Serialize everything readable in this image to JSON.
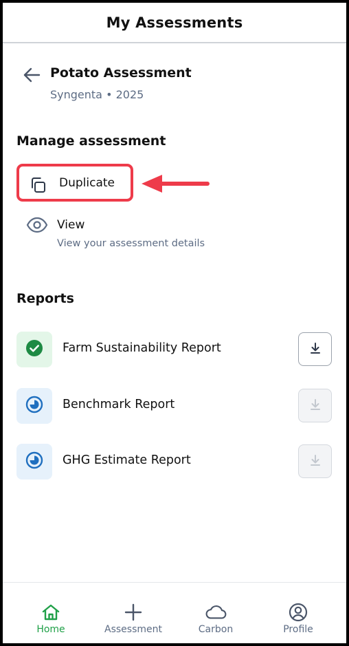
{
  "header": {
    "title": "My Assessments"
  },
  "assessment": {
    "name": "Potato Assessment",
    "subtitle": "Syngenta • 2025"
  },
  "manage": {
    "title": "Manage assessment",
    "duplicate_label": "Duplicate",
    "view_label": "View",
    "view_description": "View your assessment details"
  },
  "reports": {
    "title": "Reports",
    "items": [
      {
        "name": "Farm Sustainability Report",
        "status_icon": "check-circle-icon",
        "download_enabled": true
      },
      {
        "name": "Benchmark Report",
        "status_icon": "pending-clock-icon",
        "download_enabled": false
      },
      {
        "name": "GHG Estimate Report",
        "status_icon": "pending-clock-icon",
        "download_enabled": false
      }
    ]
  },
  "nav": {
    "items": [
      {
        "label": "Home",
        "icon": "home-icon",
        "active": true
      },
      {
        "label": "Assessment",
        "icon": "plus-icon",
        "active": false
      },
      {
        "label": "Carbon",
        "icon": "cloud-icon",
        "active": false
      },
      {
        "label": "Profile",
        "icon": "profile-icon",
        "active": false
      }
    ]
  },
  "colors": {
    "highlight": "#ee3b4a",
    "success": "#1e8a44",
    "success_bg": "#e3f6e8",
    "pending": "#1f6fbf",
    "pending_bg": "#e6f1fb",
    "active_nav": "#20a048",
    "muted_text": "#5d6c84"
  }
}
